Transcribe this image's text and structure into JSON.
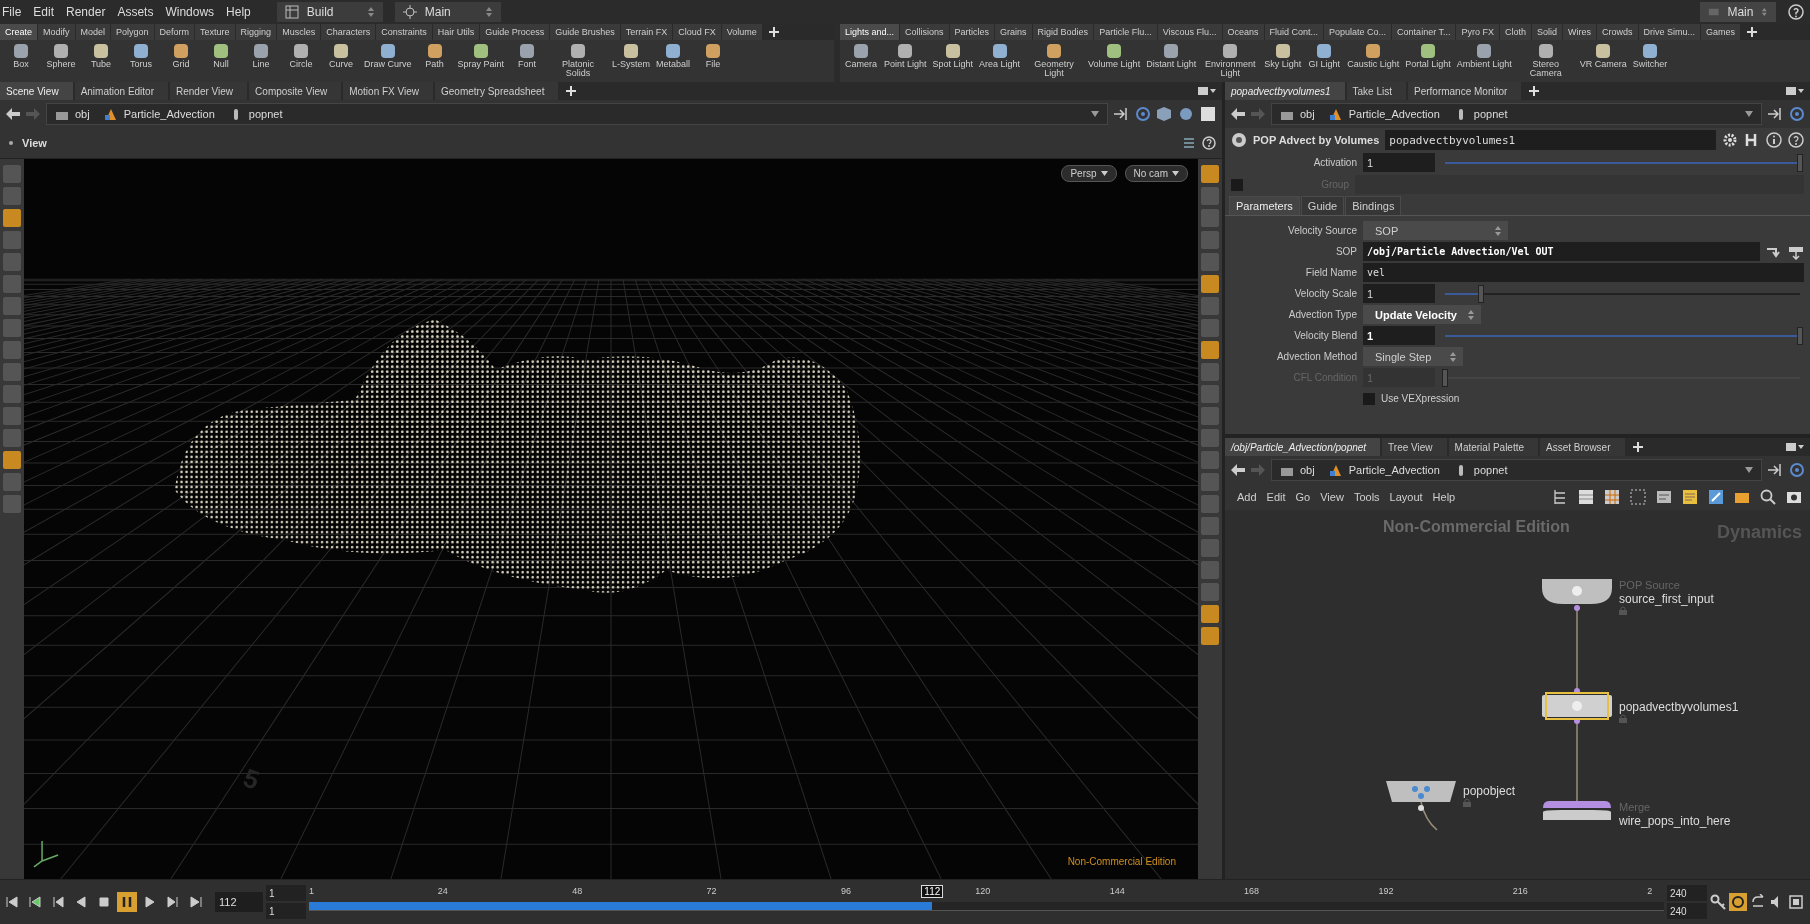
{
  "menu_bar": {
    "menus": [
      "File",
      "Edit",
      "Render",
      "Assets",
      "Windows",
      "Help"
    ],
    "desktop": "Build",
    "context": "Main",
    "right_context": "Main"
  },
  "shelf_left": {
    "tabs": [
      {
        "label": "Create",
        "selected": true
      },
      {
        "label": "Modify",
        "selected": false
      },
      {
        "label": "Model",
        "selected": false
      },
      {
        "label": "Polygon",
        "selected": false
      },
      {
        "label": "Deform",
        "selected": false
      },
      {
        "label": "Texture",
        "selected": false
      },
      {
        "label": "Rigging",
        "selected": false
      },
      {
        "label": "Muscles",
        "selected": false
      },
      {
        "label": "Characters",
        "selected": false
      },
      {
        "label": "Constraints",
        "selected": false
      },
      {
        "label": "Hair Utils",
        "selected": false
      },
      {
        "label": "Guide Process",
        "selected": false
      },
      {
        "label": "Guide Brushes",
        "selected": false
      },
      {
        "label": "Terrain FX",
        "selected": false
      },
      {
        "label": "Cloud FX",
        "selected": false
      },
      {
        "label": "Volume",
        "selected": false
      }
    ],
    "tools": [
      "Box",
      "Sphere",
      "Tube",
      "Torus",
      "Grid",
      "Null",
      "Line",
      "Circle",
      "Curve",
      "Draw Curve",
      "Path",
      "Spray Paint",
      "Font",
      "Platonic Solids",
      "L-System",
      "Metaball",
      "File"
    ]
  },
  "shelf_right": {
    "tabs": [
      {
        "label": "Lights and...",
        "selected": true
      },
      {
        "label": "Collisions",
        "selected": false
      },
      {
        "label": "Particles",
        "selected": false
      },
      {
        "label": "Grains",
        "selected": false
      },
      {
        "label": "Rigid Bodies",
        "selected": false
      },
      {
        "label": "Particle Flu...",
        "selected": false
      },
      {
        "label": "Viscous Flu...",
        "selected": false
      },
      {
        "label": "Oceans",
        "selected": false
      },
      {
        "label": "Fluid Cont...",
        "selected": false
      },
      {
        "label": "Populate Co...",
        "selected": false
      },
      {
        "label": "Container T...",
        "selected": false
      },
      {
        "label": "Pyro FX",
        "selected": false
      },
      {
        "label": "Cloth",
        "selected": false
      },
      {
        "label": "Solid",
        "selected": false
      },
      {
        "label": "Wires",
        "selected": false
      },
      {
        "label": "Crowds",
        "selected": false
      },
      {
        "label": "Drive Simu...",
        "selected": false
      },
      {
        "label": "Games",
        "selected": false
      }
    ],
    "tools": [
      "Camera",
      "Point Light",
      "Spot Light",
      "Area Light",
      "Geometry Light",
      "Volume Light",
      "Distant Light",
      "Environment Light",
      "Sky Light",
      "GI Light",
      "Caustic Light",
      "Portal Light",
      "Ambient Light",
      "Stereo Camera",
      "VR Camera",
      "Switcher"
    ]
  },
  "scene_pane": {
    "tabs": [
      {
        "label": "Scene View",
        "selected": true
      },
      {
        "label": "Animation Editor",
        "selected": false
      },
      {
        "label": "Render View",
        "selected": false
      },
      {
        "label": "Composite View",
        "selected": false
      },
      {
        "label": "Motion FX View",
        "selected": false
      },
      {
        "label": "Geometry Spreadsheet",
        "selected": false
      }
    ],
    "path": [
      "obj",
      "Particle_Advection",
      "popnet"
    ],
    "title": "View",
    "camera_buttons": [
      "Persp",
      "No cam"
    ],
    "grid_label": "5",
    "watermark": "Non-Commercial Edition",
    "left_tools": [
      {
        "selected": false
      },
      {
        "selected": false
      },
      {
        "selected": true
      },
      {
        "selected": false
      },
      {
        "selected": false
      },
      {
        "selected": false
      },
      {
        "selected": false
      },
      {
        "selected": false
      },
      {
        "selected": false
      },
      {
        "selected": false
      },
      {
        "selected": false
      },
      {
        "selected": false
      },
      {
        "selected": false
      },
      {
        "selected": true
      },
      {
        "selected": false
      },
      {
        "selected": false
      }
    ],
    "right_tools": [
      {
        "selected": true
      },
      {
        "selected": false
      },
      {
        "selected": false
      },
      {
        "selected": false
      },
      {
        "selected": false
      },
      {
        "selected": true
      },
      {
        "selected": false
      },
      {
        "selected": false
      },
      {
        "selected": true
      },
      {
        "selected": false
      },
      {
        "selected": false
      },
      {
        "selected": false
      },
      {
        "selected": false
      },
      {
        "selected": false
      },
      {
        "selected": false
      },
      {
        "selected": false
      },
      {
        "selected": false
      },
      {
        "selected": false
      },
      {
        "selected": false
      },
      {
        "selected": false
      },
      {
        "selected": true
      },
      {
        "selected": true
      }
    ]
  },
  "parameter_pane": {
    "tabs": [
      {
        "label": "popadvectbyvolumes1",
        "selected": true
      },
      {
        "label": "Take List",
        "selected": false
      },
      {
        "label": "Performance Monitor",
        "selected": false
      }
    ],
    "path": [
      "obj",
      "Particle_Advection",
      "popnet"
    ],
    "node_type": "POP Advect by Volumes",
    "node_name": "popadvectbyvolumes1",
    "activation": {
      "label": "Activation",
      "value": "1",
      "level": 1
    },
    "group": {
      "label": "Group",
      "checked": false,
      "disabled": true
    },
    "param_tabs": [
      {
        "label": "Parameters",
        "selected": true
      },
      {
        "label": "Guide",
        "selected": false
      },
      {
        "label": "Bindings",
        "selected": false
      }
    ],
    "parameters": [
      {
        "kind": "menu",
        "label": "Velocity Source",
        "value": "SOP",
        "changed": false,
        "disabled": false
      },
      {
        "kind": "path",
        "label": "SOP",
        "value": "/obj/Particle_Advection/Vel_OUT",
        "changed": true,
        "disabled": false
      },
      {
        "kind": "text",
        "label": "Field Name",
        "value": "vel",
        "changed": false,
        "disabled": false
      },
      {
        "kind": "slider",
        "label": "Velocity Scale",
        "value": "1",
        "level": 0.1,
        "changed": false,
        "disabled": false
      },
      {
        "kind": "menu",
        "label": "Advection Type",
        "value": "Update Velocity",
        "changed": true,
        "disabled": false
      },
      {
        "kind": "slider",
        "label": "Velocity Blend",
        "value": "1",
        "level": 1,
        "changed": true,
        "disabled": false
      },
      {
        "kind": "menu",
        "label": "Advection Method",
        "value": "Single Step",
        "changed": false,
        "disabled": false
      },
      {
        "kind": "slider",
        "label": "CFL Condition",
        "value": "1",
        "level": 0,
        "changed": false,
        "disabled": true
      },
      {
        "kind": "checkbox",
        "label": "Use VEXpression",
        "checked": false,
        "changed": false,
        "disabled": false
      }
    ]
  },
  "network_pane": {
    "tabs": [
      {
        "label": "/obj/Particle_Advection/popnet",
        "selected": true
      },
      {
        "label": "Tree View",
        "selected": false
      },
      {
        "label": "Material Palette",
        "selected": false
      },
      {
        "label": "Asset Browser",
        "selected": false
      }
    ],
    "path": [
      "obj",
      "Particle_Advection",
      "popnet"
    ],
    "menus": [
      "Add",
      "Edit",
      "Go",
      "View",
      "Tools",
      "Layout",
      "Help"
    ],
    "watermark": "Non-Commercial Edition",
    "context_label": "Dynamics",
    "nodes": [
      {
        "kind": "source",
        "type": "POP Source",
        "name": "source_first_input",
        "selected": false
      },
      {
        "kind": "box",
        "name": "popadvectbyvolumes1",
        "selected": true
      },
      {
        "kind": "object",
        "name": "popobject",
        "selected": false
      },
      {
        "kind": "merge",
        "type": "Merge",
        "name": "wire_pops_into_here",
        "selected": false
      }
    ]
  },
  "timeline": {
    "current_frame": "112",
    "playing": true,
    "start": [
      "1",
      "1"
    ],
    "ticks": [
      "1",
      "24",
      "48",
      "72",
      "96",
      "120",
      "144",
      "168",
      "192",
      "216",
      "2"
    ],
    "marker": "112",
    "level": 0.46,
    "end": [
      "240",
      "240"
    ]
  }
}
